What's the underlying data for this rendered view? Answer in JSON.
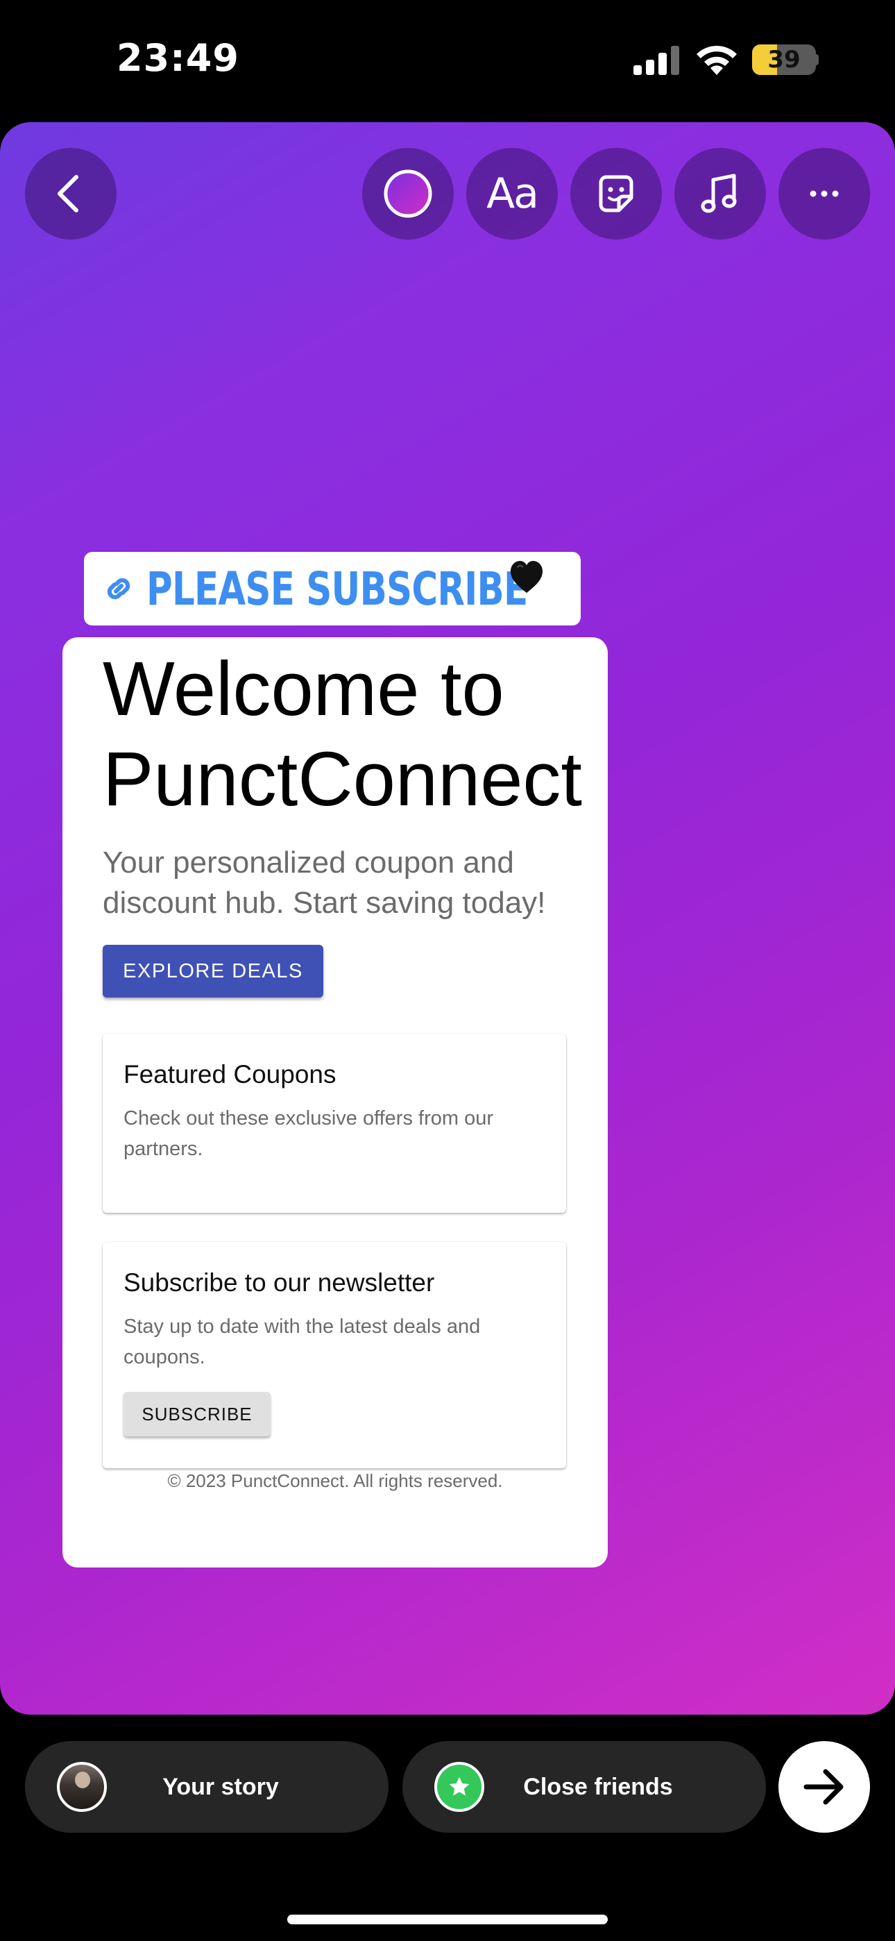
{
  "status_bar": {
    "time": "23:49",
    "battery": "39",
    "battery_level": 0.39
  },
  "toolbar": {
    "back_icon": "chevron-left-icon",
    "color_icon": "color-circle-icon",
    "text_label": "Aa",
    "sticker_icon": "sticker-icon",
    "music_icon": "music-note-icon",
    "more_icon": "ellipsis-icon"
  },
  "link_sticker": {
    "text": "PLEASE SUBSCRIBE",
    "icon": "link-icon",
    "emoji": "black-heart"
  },
  "webpage": {
    "hero_title": "Welcome to PunctConnect",
    "hero_subtitle": "Your personalized coupon and discount hub. Start saving today!",
    "explore_button": "EXPLORE DEALS",
    "featured": {
      "title": "Featured Coupons",
      "body": "Check out these exclusive offers from our partners."
    },
    "newsletter": {
      "title": "Subscribe to our newsletter",
      "body": "Stay up to date with the latest deals and coupons.",
      "button": "SUBSCRIBE"
    },
    "footer": "© 2023 PunctConnect. All rights reserved."
  },
  "share_bar": {
    "your_story": "Your story",
    "close_friends": "Close friends",
    "next_icon": "arrow-right-icon"
  },
  "colors": {
    "gradient_start": "#6f3ae0",
    "gradient_end": "#d02ec6",
    "link_blue": "#3d8ef0",
    "explore_button": "#3f51b5",
    "close_friends_green": "#34c759"
  }
}
